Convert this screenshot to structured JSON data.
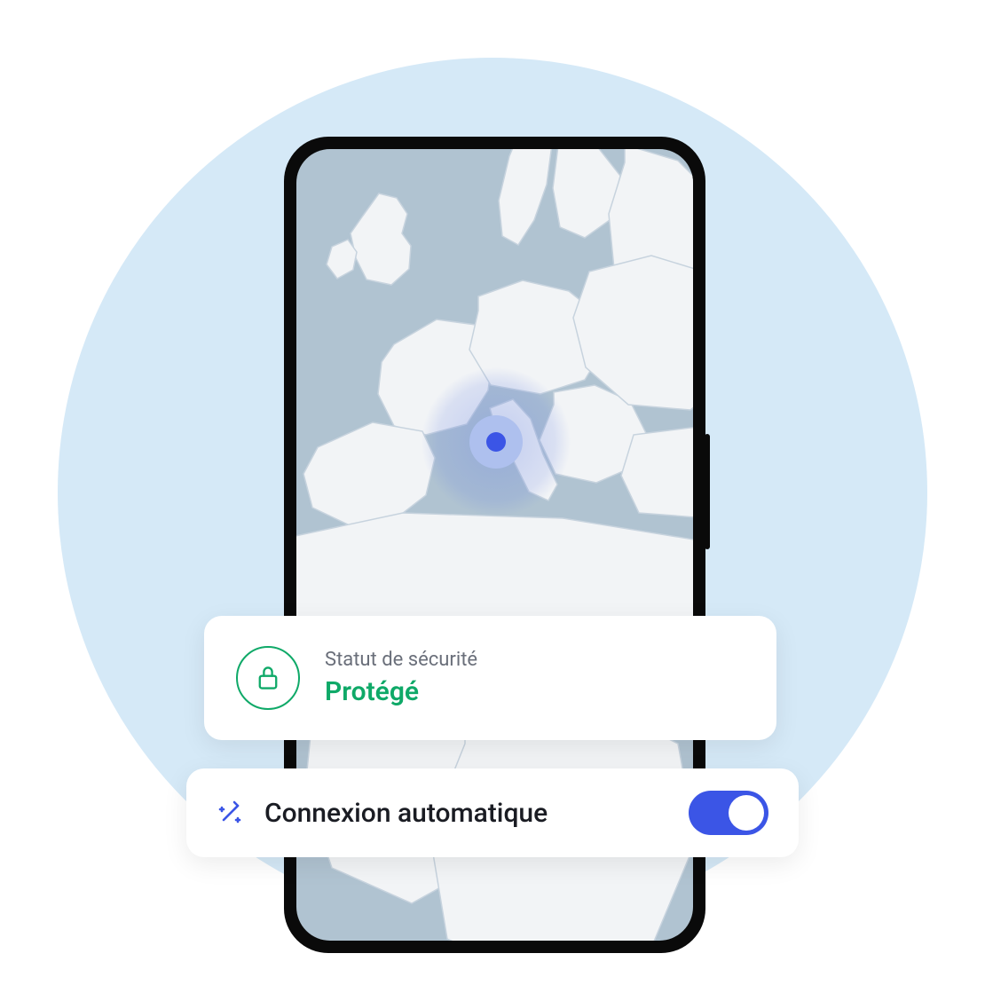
{
  "status": {
    "label": "Statut de sécurité",
    "value": "Protégé"
  },
  "autoconnect": {
    "label": "Connexion automatique",
    "enabled": true
  },
  "colors": {
    "accent": "#3b55e6",
    "success": "#0fa968",
    "bgCircle": "#d5e9f7",
    "mapWater": "#b0c3d1",
    "mapLand": "#f7f8fa"
  }
}
